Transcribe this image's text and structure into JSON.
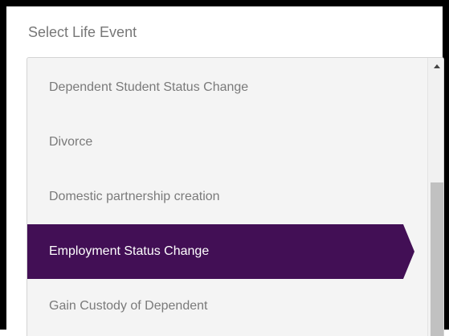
{
  "title": "Select Life Event",
  "items": [
    {
      "label": "Dependent Student Status Change",
      "selected": false
    },
    {
      "label": "Divorce",
      "selected": false
    },
    {
      "label": "Domestic partnership creation",
      "selected": false
    },
    {
      "label": "Employment Status Change",
      "selected": true
    },
    {
      "label": "Gain Custody of Dependent",
      "selected": false
    }
  ],
  "colors": {
    "selected_background": "#420f55",
    "selected_text": "#ffffff",
    "item_text": "#7a7a7a",
    "panel_background": "#f4f4f4"
  },
  "icons": {
    "scroll_up": "triangle-up-icon",
    "selected_marker": "arrow-pointer-icon"
  }
}
